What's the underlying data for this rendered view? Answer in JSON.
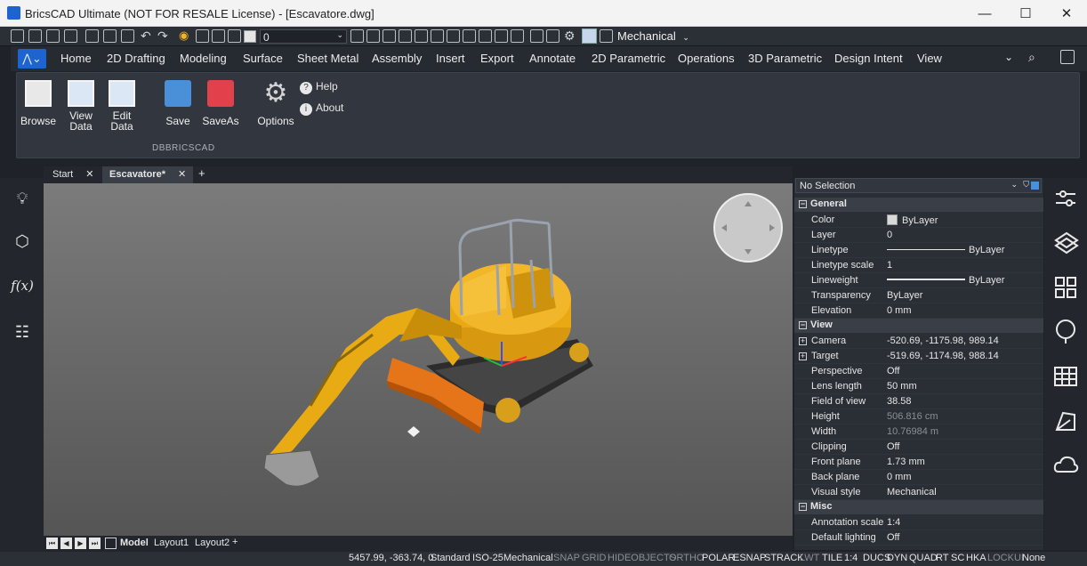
{
  "window": {
    "title": "BricsCAD Ultimate (NOT FOR RESALE License) - [Escavatore.dwg]",
    "minimize": "—",
    "maximize": "☐",
    "close": "✕"
  },
  "qat": {
    "color_value": "0",
    "workspace": "Mechanical"
  },
  "ribbon": {
    "tabs": [
      "Home",
      "2D Drafting",
      "Modeling",
      "Surface",
      "Sheet Metal",
      "Assembly",
      "Insert",
      "Export",
      "Annotate",
      "2D Parametric",
      "Operations",
      "3D Parametric",
      "Design Intent",
      "View"
    ],
    "buttons": {
      "browse": "Browse",
      "view_data_1": "View",
      "view_data_2": "Data",
      "edit_data_1": "Edit",
      "edit_data_2": "Data",
      "save": "Save",
      "saveas": "SaveAs",
      "options": "Options",
      "help": "Help",
      "about": "About"
    },
    "panel_label": "DBBRICSCAD"
  },
  "doc_tabs": {
    "start": "Start",
    "active": "Escavatore*",
    "add": "+"
  },
  "layout_tabs": {
    "model": "Model",
    "layout1": "Layout1",
    "layout2": "Layout2",
    "add": "+"
  },
  "status": {
    "coords": "5457.99, -363.74, 0",
    "items": [
      {
        "t": "Standard",
        "on": true
      },
      {
        "t": "ISO-25",
        "on": true
      },
      {
        "t": "Mechanical",
        "on": true
      },
      {
        "t": "SNAP",
        "on": false
      },
      {
        "t": "GRID",
        "on": false
      },
      {
        "t": "HIDEOBJECTS",
        "on": false
      },
      {
        "t": "ORTHO",
        "on": false
      },
      {
        "t": "POLAR",
        "on": true
      },
      {
        "t": "ESNAP",
        "on": true
      },
      {
        "t": "STRACK",
        "on": true
      },
      {
        "t": "LWT",
        "on": false
      },
      {
        "t": "TILE",
        "on": true
      },
      {
        "t": "1:4",
        "on": true
      },
      {
        "t": "DUCS",
        "on": true
      },
      {
        "t": "DYN",
        "on": true
      },
      {
        "t": "QUAD",
        "on": true
      },
      {
        "t": "RT",
        "on": true
      },
      {
        "t": "SC",
        "on": true
      },
      {
        "t": "HKA",
        "on": true
      },
      {
        "t": "LOCKUI",
        "on": false
      },
      {
        "t": "None",
        "on": true
      }
    ]
  },
  "properties": {
    "selection": "No Selection",
    "general": {
      "title": "General",
      "rows": [
        {
          "k": "Color",
          "v": "ByLayer"
        },
        {
          "k": "Layer",
          "v": "0"
        },
        {
          "k": "Linetype",
          "v": "ByLayer"
        },
        {
          "k": "Linetype scale",
          "v": "1"
        },
        {
          "k": "Lineweight",
          "v": "ByLayer"
        },
        {
          "k": "Transparency",
          "v": "ByLayer"
        },
        {
          "k": "Elevation",
          "v": "0 mm"
        }
      ]
    },
    "view": {
      "title": "View",
      "rows": [
        {
          "k": "Camera",
          "v": "-520.69, -1175.98, 989.14"
        },
        {
          "k": "Target",
          "v": "-519.69, -1174.98, 988.14"
        },
        {
          "k": "Perspective",
          "v": "Off"
        },
        {
          "k": "Lens length",
          "v": "50 mm"
        },
        {
          "k": "Field of view",
          "v": "38.58"
        },
        {
          "k": "Height",
          "v": "506.816 cm"
        },
        {
          "k": "Width",
          "v": "10.76984 m"
        },
        {
          "k": "Clipping",
          "v": "Off"
        },
        {
          "k": "Front plane",
          "v": "1.73 mm"
        },
        {
          "k": "Back plane",
          "v": "0 mm"
        },
        {
          "k": "Visual style",
          "v": "Mechanical"
        }
      ]
    },
    "misc": {
      "title": "Misc",
      "rows": [
        {
          "k": "Annotation scale",
          "v": "1:4"
        },
        {
          "k": "Default lighting",
          "v": "Off"
        }
      ]
    }
  },
  "icons": [
    "bulb-icon",
    "cube-icon",
    "function-icon",
    "tree-icon",
    "properties-icon",
    "layers-icon",
    "panels-icon",
    "balloon-icon",
    "table-icon",
    "render-icon",
    "cloud-icon"
  ]
}
